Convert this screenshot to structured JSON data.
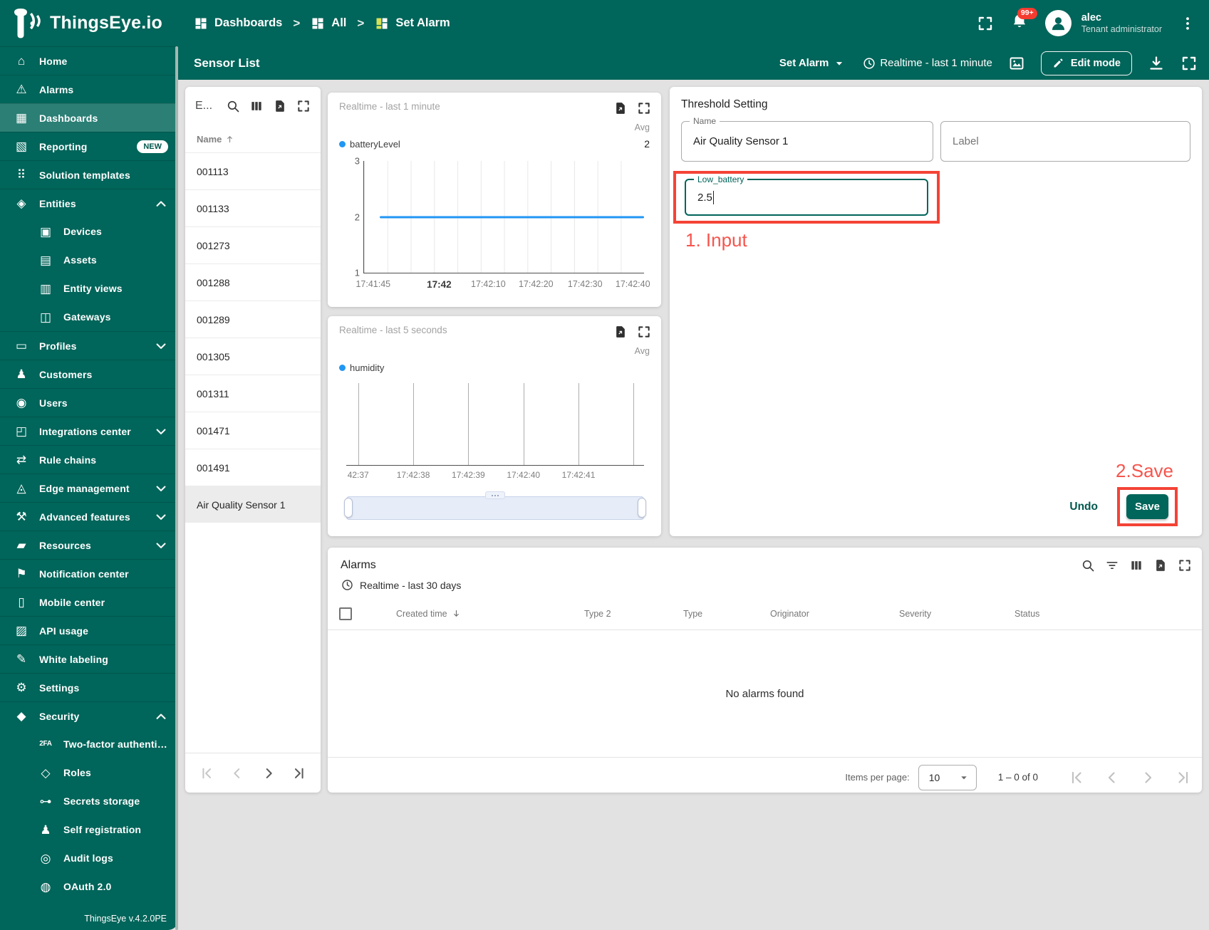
{
  "app": {
    "brand": "ThingsEye.io",
    "version": "ThingsEye v.4.2.0PE"
  },
  "colors": {
    "primary": "#00655a",
    "annotation_red": "#f44336",
    "chart_blue": "#2196f3",
    "badge_red": "#f43b30"
  },
  "header": {
    "breadcrumbs": [
      {
        "label": "Dashboards",
        "icon": "dashboard-grid",
        "sep": ""
      },
      {
        "label": "All",
        "icon": "dashboard-grid",
        "sep": ">"
      },
      {
        "label": "Set Alarm",
        "icon": "dashboard-grid-colored",
        "sep": ">"
      }
    ],
    "notification_count": "99+",
    "user": {
      "name": "alec",
      "role": "Tenant administrator"
    }
  },
  "sidebar": {
    "items": [
      {
        "label": "Home",
        "icon": "home-icon"
      },
      {
        "label": "Alarms",
        "icon": "alarms-icon"
      },
      {
        "label": "Dashboards",
        "icon": "dashboards-icon",
        "selected": true
      },
      {
        "label": "Reporting",
        "icon": "reporting-icon",
        "badge": "NEW"
      },
      {
        "label": "Solution templates",
        "icon": "solution-templates-icon"
      },
      {
        "label": "Entities",
        "icon": "entities-icon",
        "expand": "chevron-up"
      },
      {
        "label": "Devices",
        "icon": "devices-icon",
        "sub": true
      },
      {
        "label": "Assets",
        "icon": "assets-icon",
        "sub": true
      },
      {
        "label": "Entity views",
        "icon": "entity-views-icon",
        "sub": true
      },
      {
        "label": "Gateways",
        "icon": "gateways-icon",
        "sub": true
      },
      {
        "label": "Profiles",
        "icon": "profiles-icon",
        "expand": "chevron-down"
      },
      {
        "label": "Customers",
        "icon": "customers-icon"
      },
      {
        "label": "Users",
        "icon": "users-icon"
      },
      {
        "label": "Integrations center",
        "icon": "integrations-center-icon",
        "expand": "chevron-down"
      },
      {
        "label": "Rule chains",
        "icon": "rule-chains-icon"
      },
      {
        "label": "Edge management",
        "icon": "edge-management-icon",
        "expand": "chevron-down"
      },
      {
        "label": "Advanced features",
        "icon": "advanced-features-icon",
        "expand": "chevron-down"
      },
      {
        "label": "Resources",
        "icon": "resources-icon",
        "expand": "chevron-down"
      },
      {
        "label": "Notification center",
        "icon": "notification-center-icon"
      },
      {
        "label": "Mobile center",
        "icon": "mobile-center-icon"
      },
      {
        "label": "API usage",
        "icon": "api-usage-icon"
      },
      {
        "label": "White labeling",
        "icon": "white-labeling-icon"
      },
      {
        "label": "Settings",
        "icon": "settings-icon"
      },
      {
        "label": "Security",
        "icon": "security-icon",
        "expand": "chevron-up"
      },
      {
        "label": "Two-factor authenticati…",
        "icon": "two-factor-icon",
        "sub": true,
        "icon_small": true
      },
      {
        "label": "Roles",
        "icon": "roles-icon",
        "sub": true
      },
      {
        "label": "Secrets storage",
        "icon": "secrets-storage-icon",
        "sub": true
      },
      {
        "label": "Self registration",
        "icon": "self-registration-icon",
        "sub": true
      },
      {
        "label": "Audit logs",
        "icon": "audit-logs-icon",
        "sub": true
      },
      {
        "label": "OAuth 2.0",
        "icon": "oauth-icon",
        "sub": true
      }
    ]
  },
  "icons": {
    "home-icon": "⌂",
    "alarms-icon": "⚠",
    "dashboards-icon": "▦",
    "reporting-icon": "▧",
    "solution-templates-icon": "⠿",
    "entities-icon": "◈",
    "devices-icon": "▣",
    "assets-icon": "▤",
    "entity-views-icon": "▥",
    "gateways-icon": "◫",
    "profiles-icon": "▭",
    "customers-icon": "♟",
    "users-icon": "◉",
    "integrations-center-icon": "◰",
    "rule-chains-icon": "⇄",
    "edge-management-icon": "◬",
    "advanced-features-icon": "⚒",
    "resources-icon": "▰",
    "notification-center-icon": "⚑",
    "mobile-center-icon": "▯",
    "api-usage-icon": "▨",
    "white-labeling-icon": "✎",
    "settings-icon": "⚙",
    "security-icon": "◆",
    "two-factor-icon": "2FA",
    "roles-icon": "◇",
    "secrets-storage-icon": "⊶",
    "self-registration-icon": "♟",
    "audit-logs-icon": "◎",
    "oauth-icon": "◍"
  },
  "toolbar": {
    "title": "Sensor List",
    "state_button": "Set Alarm",
    "timewindow": "Realtime - last 1 minute",
    "edit_button": "Edit mode"
  },
  "sensor_list": {
    "title": "E...",
    "column_name": "Name",
    "rows": [
      {
        "name": "001113"
      },
      {
        "name": "001133"
      },
      {
        "name": "001273"
      },
      {
        "name": "001288"
      },
      {
        "name": "001289"
      },
      {
        "name": "001305"
      },
      {
        "name": "001311"
      },
      {
        "name": "001471"
      },
      {
        "name": "001491"
      },
      {
        "name": "Air Quality Sensor 1",
        "selected": true
      }
    ]
  },
  "chart_data": [
    {
      "type": "line",
      "title": "Realtime - last 1 minute",
      "legend_position": "top-left",
      "grid": true,
      "series": [
        {
          "name": "batteryLevel",
          "color": "#2196f3",
          "value": 2
        }
      ],
      "avg_label": "Avg",
      "avg_value": "2",
      "ylim": [
        1,
        3
      ],
      "y_ticks": [
        "3",
        "2",
        "1"
      ],
      "x_ticks": [
        {
          "label": "17:41:45",
          "bold": false
        },
        {
          "label": "17:42",
          "bold": true
        },
        {
          "label": "17:42:10",
          "bold": false
        },
        {
          "label": "17:42:20",
          "bold": false
        },
        {
          "label": "17:42:30",
          "bold": false
        },
        {
          "label": "17:42:40",
          "bold": false
        }
      ]
    },
    {
      "type": "line",
      "title": "Realtime - last 5 seconds",
      "legend_position": "top-left",
      "grid": true,
      "series": [
        {
          "name": "humidity",
          "color": "#2196f3"
        }
      ],
      "values": [],
      "avg_label": "Avg",
      "avg_value": "",
      "x_ticks": [
        {
          "label": "42:37"
        },
        {
          "label": "17:42:38"
        },
        {
          "label": "17:42:39"
        },
        {
          "label": "17:42:40"
        },
        {
          "label": "17:42:41"
        }
      ]
    }
  ],
  "threshold": {
    "title": "Threshold Setting",
    "name_label": "Name",
    "name_value": "Air Quality Sensor 1",
    "label_placeholder": "Label",
    "field_label": "Low_battery",
    "field_value": "2.5",
    "undo_button": "Undo",
    "save_button": "Save"
  },
  "annotations": {
    "step1": "1. Input",
    "step2": "2.Save"
  },
  "alarms": {
    "title": "Alarms",
    "timewindow": "Realtime - last 30 days",
    "columns": [
      "Created time",
      "Type 2",
      "Type",
      "Originator",
      "Severity",
      "Status"
    ],
    "empty_text": "No alarms found",
    "items_per_page_label": "Items per page:",
    "page_size": "10",
    "range_label": "1 – 0 of 0"
  }
}
